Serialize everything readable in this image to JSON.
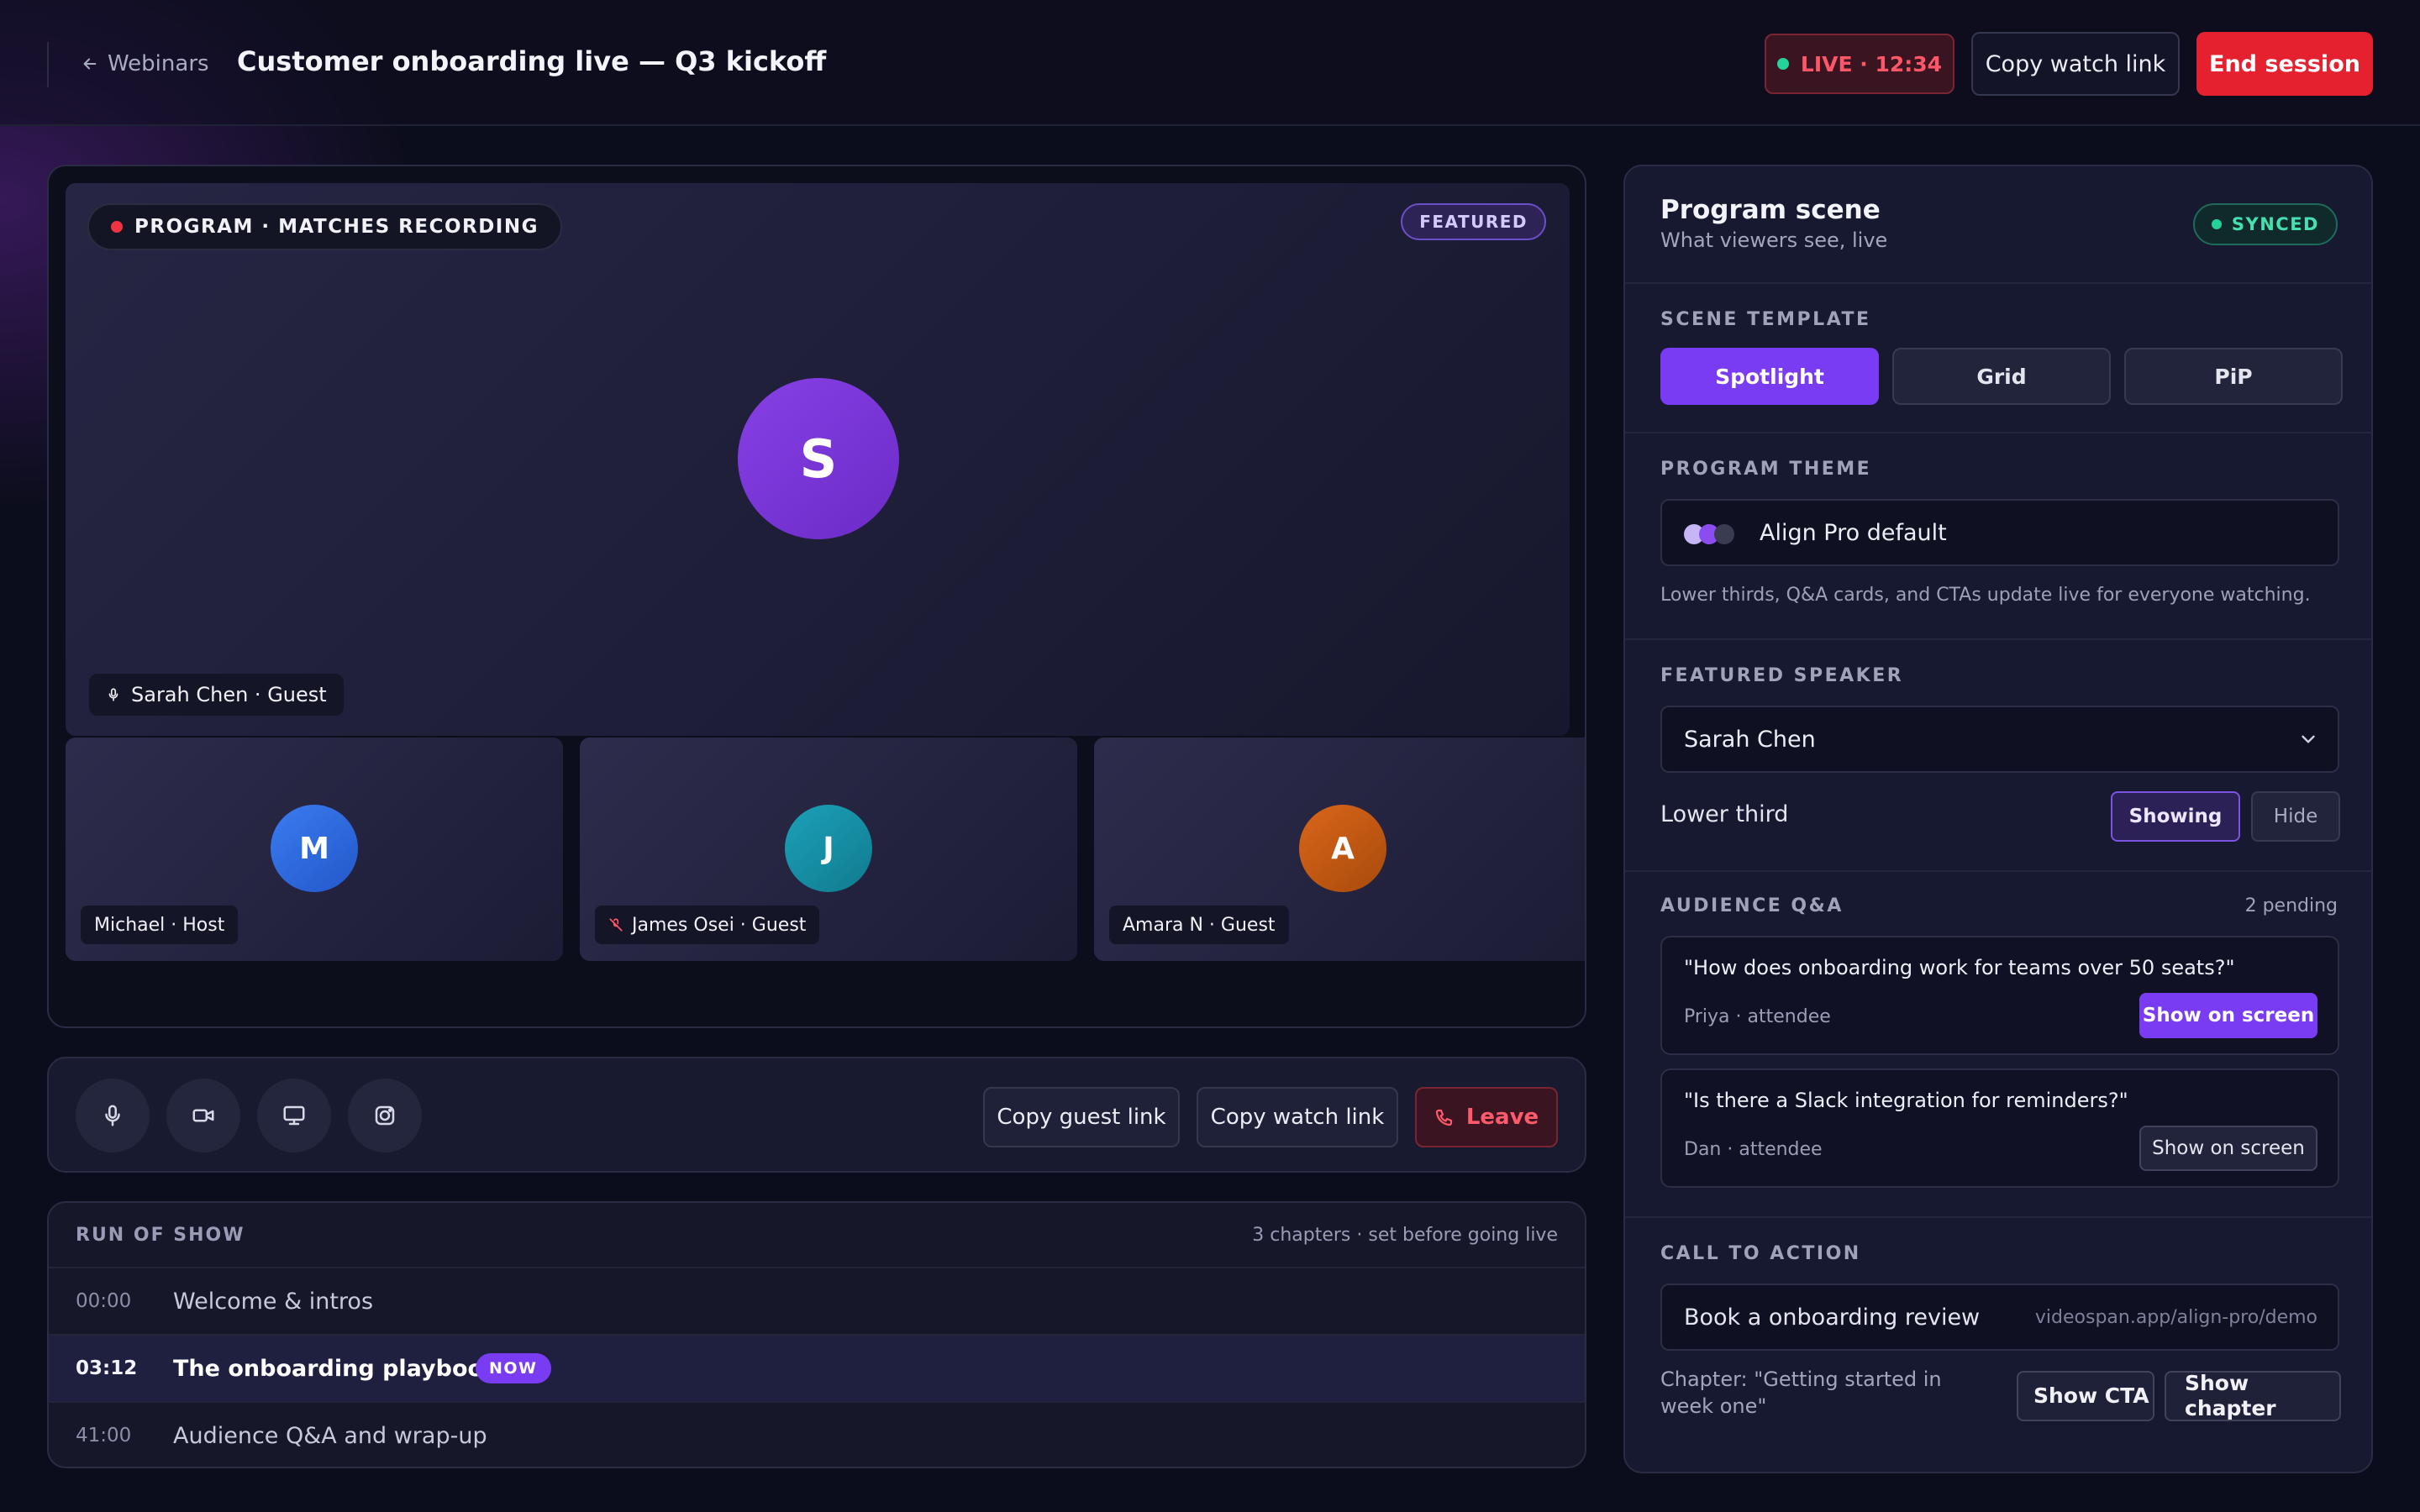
{
  "header": {
    "back_label": "Webinars",
    "title": "Customer onboarding live — Q3 kickoff",
    "live_label": "LIVE · 12:34",
    "copy_watch_link": "Copy watch link",
    "end_session": "End session"
  },
  "stage": {
    "program_label": "PROGRAM · MATCHES RECORDING",
    "featured_badge": "FEATURED",
    "featured_initial": "S",
    "featured_name": "Sarah Chen · Guest",
    "thumbnails": [
      {
        "initial": "M",
        "name": "Michael · Host",
        "color": "#2f6fe6"
      },
      {
        "initial": "J",
        "name": "James Osei · Guest",
        "color": "#1690a8",
        "muted": true
      },
      {
        "initial": "A",
        "name": "Amara N · Guest",
        "color": "#c45a10"
      }
    ]
  },
  "controls": {
    "icons": [
      "microphone-icon",
      "camera-icon",
      "screen-share-icon",
      "record-icon"
    ],
    "copy_guest_link": "Copy guest link",
    "copy_watch_link": "Copy watch link",
    "leave": "Leave"
  },
  "run_of_show": {
    "title": "RUN OF SHOW",
    "meta": "3 chapters · set before going live",
    "chapters": [
      {
        "time": "00:00",
        "name": "Welcome & intros"
      },
      {
        "time": "03:12",
        "name": "The onboarding playbook",
        "badge": "NOW"
      },
      {
        "time": "41:00",
        "name": "Audience Q&A and wrap-up"
      }
    ]
  },
  "panel": {
    "title": "Program scene",
    "subtitle": "What viewers see, live",
    "synced": "SYNCED",
    "scene_template": {
      "label": "SCENE TEMPLATE",
      "options": [
        "Spotlight",
        "Grid",
        "PiP"
      ],
      "selected": "Spotlight"
    },
    "program_theme": {
      "label": "PROGRAM THEME",
      "value": "Align Pro default",
      "note": "Lower thirds, Q&A cards, and CTAs update live for everyone watching.",
      "swatches": [
        "#c6b6f5",
        "#8b4cf0",
        "#3a3c52"
      ]
    },
    "featured_speaker": {
      "label": "FEATURED SPEAKER",
      "value": "Sarah Chen",
      "lower_third_label": "Lower third",
      "showing": "Showing",
      "hide": "Hide"
    },
    "qa": {
      "label": "AUDIENCE Q&A",
      "pending": "2 pending",
      "items": [
        {
          "question": "\"How does onboarding work for teams over 50 seats?\"",
          "author": "Priya · attendee",
          "button": "Show on screen"
        },
        {
          "question": "\"Is there a Slack integration for reminders?\"",
          "author": "Dan · attendee",
          "button": "Show on screen"
        }
      ]
    },
    "cta": {
      "label": "CALL TO ACTION",
      "value": "Book a onboarding review",
      "url": "videospan.app/align-pro/demo",
      "chapter_text": "Chapter: \"Getting started in week one\"",
      "show_cta": "Show CTA",
      "show_chapter": "Show chapter"
    }
  },
  "colors": {
    "accent": "#7a3cf2",
    "danger": "#e5212f",
    "live_dot": "#23d39a",
    "background": "#0c0d1c"
  }
}
